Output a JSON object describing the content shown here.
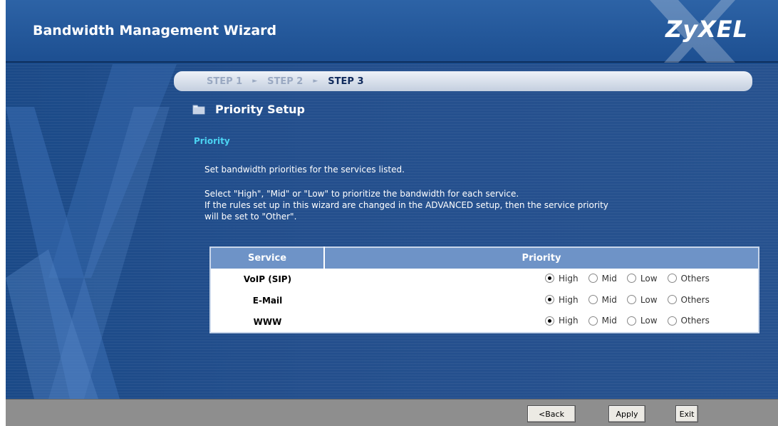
{
  "header": {
    "title": "Bandwidth Management Wizard",
    "brand": "ZyXEL"
  },
  "steps": [
    {
      "label": "STEP 1",
      "active": false
    },
    {
      "label": "STEP 2",
      "active": false
    },
    {
      "label": "STEP 3",
      "active": true
    }
  ],
  "section": {
    "title": "Priority Setup",
    "subtitle": "Priority",
    "icon": "folder-icon"
  },
  "description": {
    "line1": "Set bandwidth priorities for the services listed.",
    "line2": "Select \"High\", \"Mid\" or \"Low\" to prioritize the bandwidth for each service.",
    "line3": "If the rules set up in this wizard are changed in the ADVANCED setup, then the service priority",
    "line4": "will be set to \"Other\"."
  },
  "table": {
    "headers": {
      "service": "Service",
      "priority": "Priority"
    },
    "options": [
      "High",
      "Mid",
      "Low",
      "Others"
    ],
    "rows": [
      {
        "service": "VoIP (SIP)",
        "selected": "High"
      },
      {
        "service": "E-Mail",
        "selected": "High"
      },
      {
        "service": "WWW",
        "selected": "High"
      }
    ]
  },
  "footer": {
    "back_label": "<Back",
    "apply_label": "Apply",
    "exit_label": "Exit"
  },
  "colors": {
    "background": "#1b4c8c",
    "subheading": "#4bd4f3",
    "table_header": "#6e93c7",
    "footer": "#8e8e8e"
  }
}
